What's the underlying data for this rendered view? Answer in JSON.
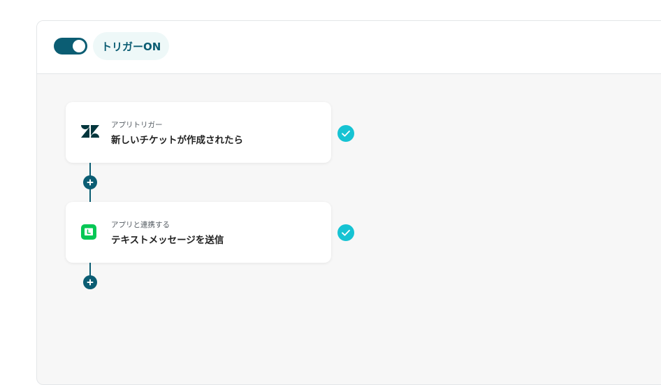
{
  "trigger": {
    "label": "トリガーON",
    "enabled": true
  },
  "flow": {
    "steps": [
      {
        "type": "アプリトリガー",
        "title": "新しいチケットが作成されたら",
        "app_icon": "zendesk-icon",
        "completed": true
      },
      {
        "type": "アプリと連携する",
        "title": "テキストメッセージを送信",
        "app_icon": "line-icon",
        "completed": true
      }
    ]
  },
  "colors": {
    "primary": "#0b5d73",
    "check": "#16c3d3",
    "line_green": "#06c755",
    "zendesk": "#03363d",
    "badge_bg": "#eef8f8",
    "canvas_bg": "#f7f7f7"
  }
}
